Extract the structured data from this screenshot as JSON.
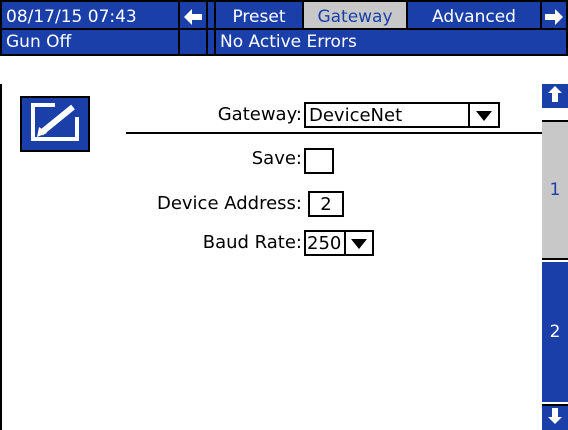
{
  "header": {
    "datetime": "08/17/15 07:43",
    "tabs": [
      {
        "label": "Preset",
        "selected": false
      },
      {
        "label": "Gateway",
        "selected": true
      },
      {
        "label": "Advanced",
        "selected": false
      }
    ],
    "nav_left_icon": "arrow-left-icon",
    "nav_right_icon": "arrow-right-icon"
  },
  "status": {
    "gun_state": "Gun Off",
    "indicator": "",
    "errors": "No Active Errors"
  },
  "screen": {
    "edit_icon": "edit-pencil-icon",
    "gateway_label": "Gateway:",
    "gateway_value": "DeviceNet",
    "save_label": "Save:",
    "save_checked": false,
    "device_address_label": "Device Address:",
    "device_address_value": "2",
    "baud_rate_label": "Baud Rate:",
    "baud_rate_value": "250"
  },
  "pager": {
    "page1": "1",
    "page2": "2",
    "up_icon": "arrow-up-icon",
    "down_icon": "arrow-down-icon",
    "current_page": 1
  },
  "colors": {
    "accent_blue": "#1a3fa8",
    "selected_gray": "#c8c8c8",
    "background": "#ffffff"
  }
}
